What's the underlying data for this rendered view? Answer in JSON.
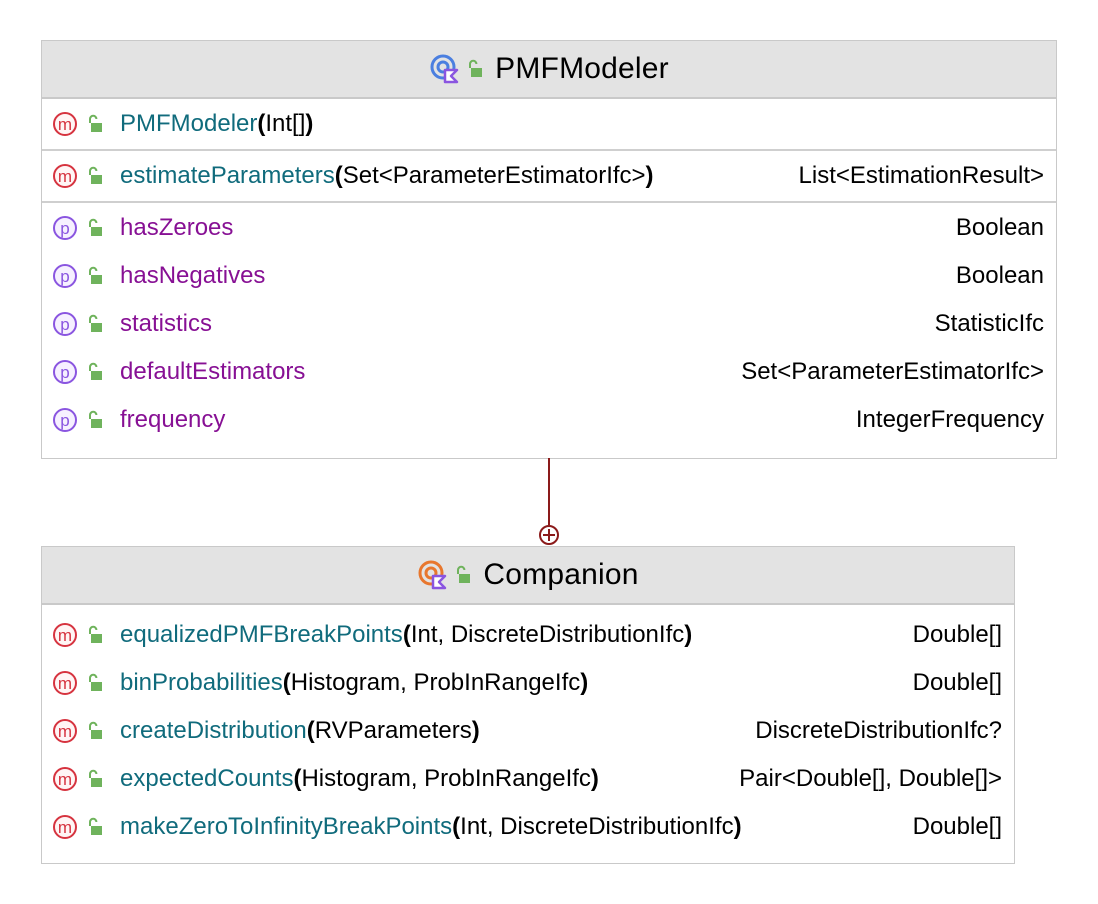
{
  "classes": [
    {
      "name": "PMFModeler",
      "kind_icon": "kotlin-class-icon",
      "visibility_icon": "public-lock-icon",
      "sections": {
        "constructors": [
          {
            "name": "PMFModeler",
            "params": "Int[]",
            "return": ""
          }
        ],
        "methods": [
          {
            "name": "estimateParameters",
            "params": "Set<ParameterEstimatorIfc>",
            "return": "List<EstimationResult>"
          }
        ],
        "properties": [
          {
            "name": "hasZeroes",
            "type": "Boolean"
          },
          {
            "name": "hasNegatives",
            "type": "Boolean"
          },
          {
            "name": "statistics",
            "type": "StatisticIfc"
          },
          {
            "name": "defaultEstimators",
            "type": "Set<ParameterEstimatorIfc>"
          },
          {
            "name": "frequency",
            "type": "IntegerFrequency"
          }
        ]
      }
    },
    {
      "name": "Companion",
      "kind_icon": "kotlin-object-icon",
      "visibility_icon": "public-lock-icon",
      "sections": {
        "methods": [
          {
            "name": "equalizedPMFBreakPoints",
            "params": "Int, DiscreteDistributionIfc",
            "return": "Double[]"
          },
          {
            "name": "binProbabilities",
            "params": "Histogram, ProbInRangeIfc",
            "return": "Double[]"
          },
          {
            "name": "createDistribution",
            "params": "RVParameters",
            "return": "DiscreteDistributionIfc?"
          },
          {
            "name": "expectedCounts",
            "params": "Histogram, ProbInRangeIfc",
            "return": "Pair<Double[], Double[]>"
          },
          {
            "name": "makeZeroToInfinityBreakPoints",
            "params": "Int, DiscreteDistributionIfc",
            "return": "Double[]"
          }
        ]
      }
    }
  ],
  "relation": {
    "type": "nested-class",
    "from": "PMFModeler",
    "to": "Companion",
    "color": "#8b1a1a"
  },
  "badges": {
    "method": "m",
    "property": "p"
  },
  "colors": {
    "method_name": "#106b7c",
    "property_name": "#871094",
    "method_badge": "#d6333f",
    "property_badge": "#8a55e0",
    "header_bg": "#e3e3e3"
  }
}
